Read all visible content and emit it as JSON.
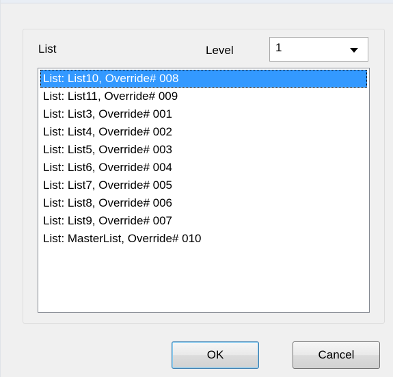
{
  "labels": {
    "list": "List",
    "level": "Level"
  },
  "level_combo": {
    "value": "1",
    "icon": "chevron-down-icon"
  },
  "list_items": [
    {
      "text": "List: List10, Override# 008",
      "selected": true
    },
    {
      "text": "List: List11, Override# 009",
      "selected": false
    },
    {
      "text": "List: List3, Override# 001",
      "selected": false
    },
    {
      "text": "List: List4, Override# 002",
      "selected": false
    },
    {
      "text": "List: List5, Override# 003",
      "selected": false
    },
    {
      "text": "List: List6, Override# 004",
      "selected": false
    },
    {
      "text": "List: List7, Override# 005",
      "selected": false
    },
    {
      "text": "List: List8, Override# 006",
      "selected": false
    },
    {
      "text": "List: List9, Override# 007",
      "selected": false
    },
    {
      "text": "List: MasterList, Override# 010",
      "selected": false
    }
  ],
  "buttons": {
    "ok": "OK",
    "cancel": "Cancel"
  },
  "colors": {
    "dialog_background": "#f0f0f0",
    "selection": "#3399ff",
    "selection_text": "#ffffff"
  }
}
